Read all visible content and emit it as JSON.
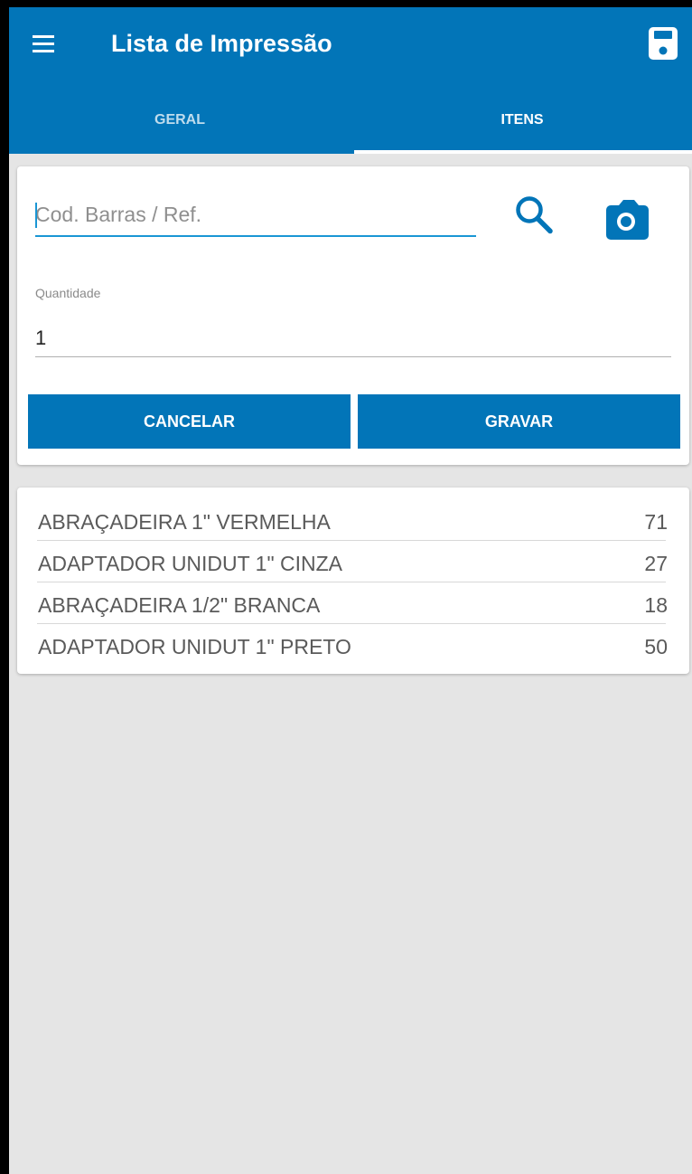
{
  "appbar": {
    "title": "Lista de Impressão",
    "menu_icon": "hamburger-menu-icon",
    "save_icon": "floppy-disk-icon",
    "background_color": "#0275b8"
  },
  "tabs": [
    {
      "label": "GERAL",
      "active": false
    },
    {
      "label": "ITENS",
      "active": true
    }
  ],
  "form": {
    "search_placeholder": "Cod. Barras / Ref.",
    "search_value": "",
    "search_icon": "search-icon",
    "camera_icon": "camera-icon",
    "quantity_label": "Quantidade",
    "quantity_value": "1",
    "cancel_label": "CANCELAR",
    "save_label": "GRAVAR"
  },
  "items": [
    {
      "name": "ABRAÇADEIRA 1\" VERMELHA",
      "qty": "71"
    },
    {
      "name": "ADAPTADOR UNIDUT 1\" CINZA",
      "qty": "27"
    },
    {
      "name": "ABRAÇADEIRA 1/2\" BRANCA",
      "qty": "18"
    },
    {
      "name": "ADAPTADOR UNIDUT 1\" PRETO",
      "qty": "50"
    }
  ]
}
